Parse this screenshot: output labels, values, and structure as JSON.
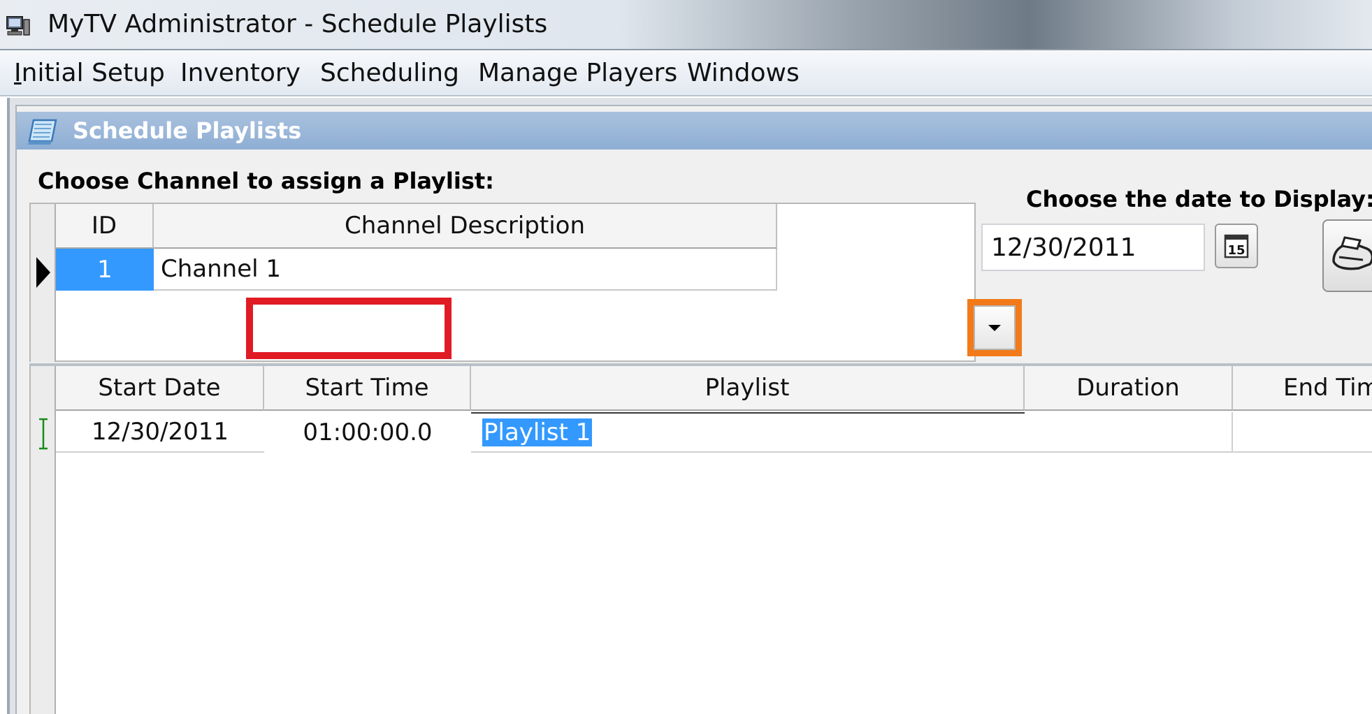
{
  "window": {
    "title": "MyTV Administrator - Schedule Playlists",
    "icon": "computer-icon"
  },
  "menu": {
    "items": [
      {
        "label_u": "I",
        "label_rest": "nitial Setup"
      },
      {
        "label_u": "",
        "label_rest": "Inventory"
      },
      {
        "label_u": "",
        "label_rest": "Scheduling"
      },
      {
        "label_u": "",
        "label_rest": "Manage Players"
      },
      {
        "label_u": "",
        "label_rest": "Windows"
      }
    ]
  },
  "child_window": {
    "title": "Schedule Playlists",
    "icon": "schedule-icon"
  },
  "channel_section": {
    "label": "Choose Channel to assign a Playlist:",
    "columns": [
      "ID",
      "Channel Description"
    ],
    "rows": [
      {
        "id": "1",
        "description": "Channel 1"
      }
    ]
  },
  "date_section": {
    "label": "Choose the date to Display:",
    "value": "12/30/2011",
    "calendar_button_label": "15"
  },
  "schedule_grid": {
    "columns": [
      "Start Date",
      "Start Time",
      "Playlist",
      "Duration",
      "End Tim"
    ],
    "rows": [
      {
        "start_date": "12/30/2011",
        "start_time": "01:00:00.0",
        "playlist": "Playlist 1",
        "duration": "",
        "end_time": ""
      }
    ]
  },
  "colors": {
    "selection": "#3399ff",
    "highlight_red": "#e01b24",
    "highlight_orange": "#f27a1a",
    "child_titlebar": "#8eaed4"
  }
}
